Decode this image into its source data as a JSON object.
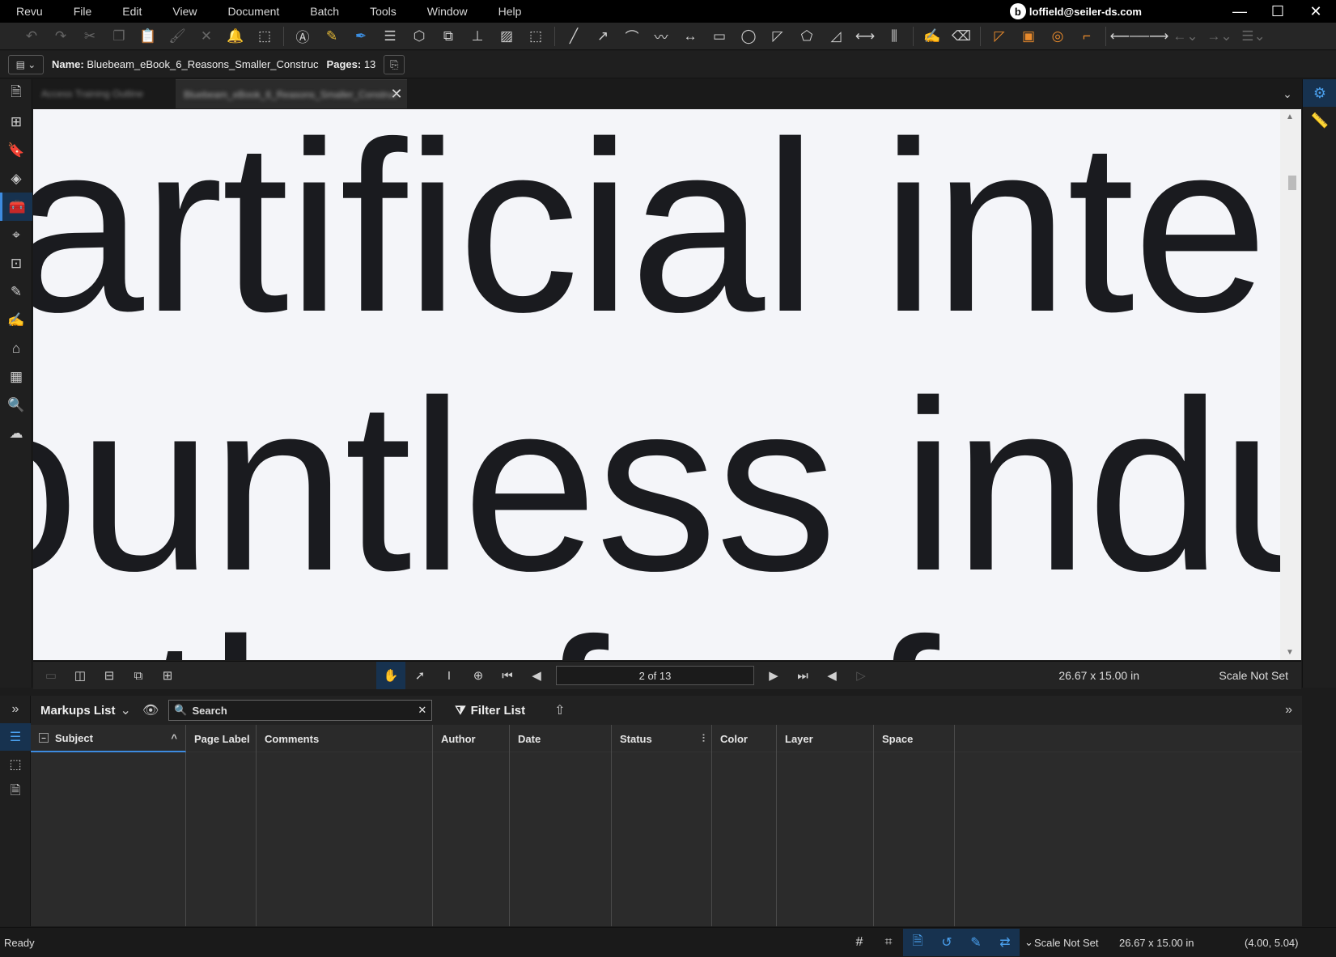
{
  "menubar": {
    "items": [
      "Revu",
      "File",
      "Edit",
      "View",
      "Document",
      "Batch",
      "Tools",
      "Window",
      "Help"
    ],
    "account": "loffield@seiler-ds.com",
    "logo_glyph": "b",
    "minimize": "—",
    "maximize": "☐",
    "close": "✕"
  },
  "toolbar": {
    "icons": [
      "undo-icon",
      "redo-icon",
      "cut-icon",
      "copy-icon",
      "paste-icon",
      "format-painter-icon",
      "delete-icon",
      "bell-icon",
      "select-region-icon",
      "text-box-icon",
      "highlight-icon",
      "pen-icon",
      "callout-icon",
      "cloud-icon",
      "note-icon",
      "stamp-icon",
      "image-icon",
      "crop-icon",
      "line-icon",
      "arrow-icon",
      "arc-icon",
      "polyline-icon",
      "dimension-icon",
      "rectangle-icon",
      "ellipse-icon",
      "polygon-icon",
      "area-icon",
      "perimeter-icon",
      "length-icon",
      "count-icon",
      "sketch-icon",
      "eraser-icon"
    ]
  },
  "docbar": {
    "name_label": "Name:",
    "name_value": "Bluebeam_eBook_6_Reasons_Smaller_Construc",
    "pages_label": "Pages:",
    "pages_value": "13"
  },
  "tabs": {
    "items": [
      "Access Training Outline",
      "Bluebeam_eBook_6_Reasons_Smaller_Construc"
    ],
    "active_index": 1,
    "close_glyph": "✕",
    "overflow_glyph": "⌄"
  },
  "canvas": {
    "lines": [
      "artificial intell",
      "ountless indu",
      "ath of a f"
    ]
  },
  "navbar": {
    "page_display": "2 of 13",
    "dimensions": "26.67 x 15.00 in",
    "scale": "Scale Not Set"
  },
  "markups": {
    "title": "Markups List",
    "search_placeholder": "Search",
    "filter_label": "Filter List",
    "columns": [
      "Subject",
      "Page Label",
      "Comments",
      "Author",
      "Date",
      "Status",
      "Color",
      "Layer",
      "Space"
    ]
  },
  "statusbar": {
    "ready": "Ready",
    "scale": "Scale Not Set",
    "dimensions": "26.67 x 15.00 in",
    "coordinates": "(4.00, 5.04)"
  },
  "colors": {
    "accent": "#3d8be0",
    "active_bg": "#17324f",
    "canvas_bg": "#f4f5f9",
    "text_dark": "#1a1b1f"
  }
}
